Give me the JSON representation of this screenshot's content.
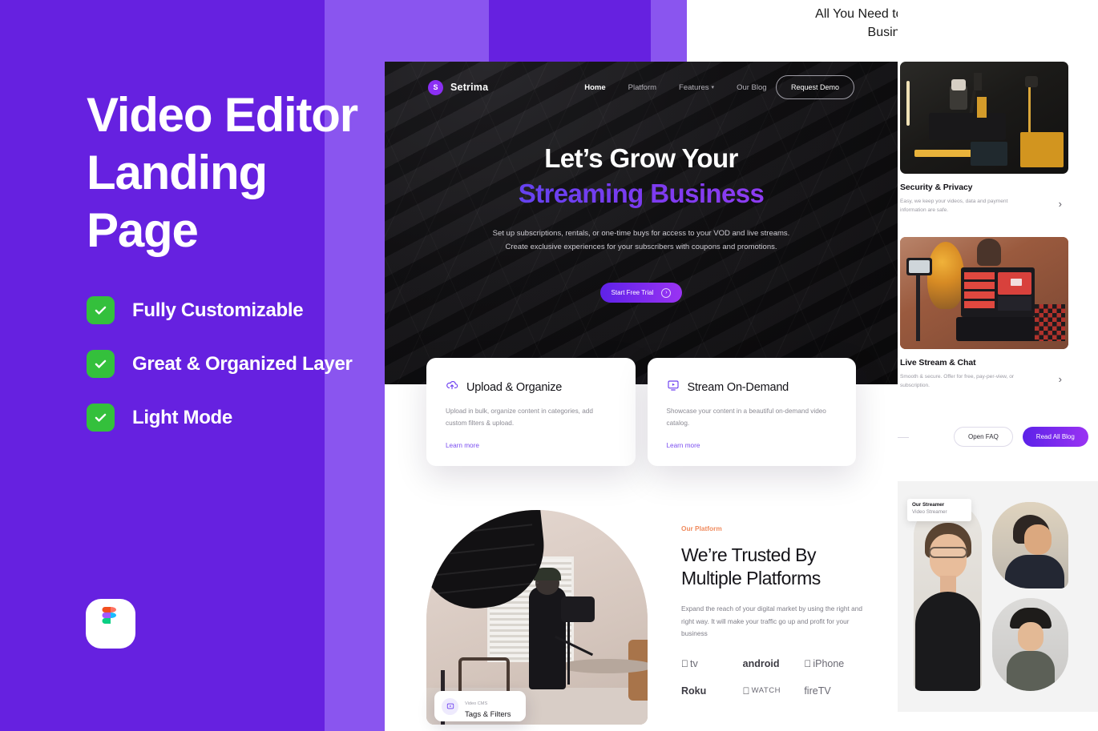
{
  "poster": {
    "title_line1": "Video Editor",
    "title_line2": "Landing Page",
    "features": [
      {
        "label": "Fully Customizable",
        "icon": "check-icon"
      },
      {
        "label": "Great & Organized Layer",
        "icon": "check-icon"
      },
      {
        "label": "Light Mode",
        "icon": "check-icon"
      }
    ],
    "badge_icon": "figma-logo-icon",
    "bg_colors": [
      "#6621e0",
      "#8a55ef"
    ],
    "check_color": "#34c03c"
  },
  "top_right_heading": "All You Need to Power Your Business",
  "mockup": {
    "nav": {
      "brand_initial": "S",
      "brand_name": "Setrima",
      "links": [
        {
          "label": "Home",
          "active": true
        },
        {
          "label": "Platform",
          "active": false
        },
        {
          "label": "Features",
          "active": false,
          "caret": "▾"
        },
        {
          "label": "Our Blog",
          "active": false
        }
      ],
      "cta": "Request Demo"
    },
    "hero": {
      "headline_line1": "Let’s Grow Your",
      "headline_line2": "Streaming Business",
      "sub_line1": "Set up subscriptions, rentals, or one-time buys for access to your VOD and live streams.",
      "sub_line2": "Create exclusive experiences for your subscribers with coupons and promotions.",
      "cta_label": "Start Free Trial",
      "cta_icon": "arrow-right-circle-icon",
      "gradient": [
        "#4d4bf0",
        "#a23df2"
      ]
    },
    "cards": [
      {
        "icon": "cloud-upload-icon",
        "title": "Upload & Organize",
        "text": "Upload in bulk, organize content in categories, add custom filters & upload.",
        "link": "Learn more"
      },
      {
        "icon": "video-play-icon",
        "title": "Stream On-Demand",
        "text": "Showcase your content in a beautiful on-demand video catalog.",
        "link": "Learn more"
      }
    ],
    "trusted": {
      "eyebrow": "Our Platform",
      "heading_line1": "We’re Trusted By",
      "heading_line2": "Multiple Platforms",
      "paragraph": "Expand the reach of your digital market by using the right and right way. It will make your traffic go up and profit for your business",
      "photo_chip": {
        "icon": "video-play-icon",
        "subtitle": "Video CMS",
        "title": "Tags & Filters"
      },
      "logos": [
        {
          "label": "tv",
          "apple": true,
          "bold": false
        },
        {
          "label": "android",
          "apple": false,
          "bold": true
        },
        {
          "label": "iPhone",
          "apple": true,
          "bold": false
        },
        {
          "label": "Roku",
          "apple": false,
          "bold": true
        },
        {
          "label": "WATCH",
          "apple": true,
          "bold": false
        },
        {
          "label": "fireTV",
          "apple": false,
          "bold": false
        }
      ]
    }
  },
  "sidebar": {
    "items": [
      {
        "image": "studio-camera-photo",
        "title": "Security & Privacy",
        "text": "Easy, we keep your videos, data and payment information are safe.",
        "chevron": "chevron-right-icon"
      },
      {
        "image": "live-stream-setup-photo",
        "title": "Live Stream & Chat",
        "text": "Smooth & secure. Offer for free, pay-per-view, or subscription.",
        "chevron": "chevron-right-icon"
      }
    ],
    "buttons": [
      {
        "label": "Open FAQ",
        "style": "ghost"
      },
      {
        "label": "Read All Blog",
        "style": "solid"
      }
    ],
    "avatars": {
      "main_chip": {
        "title": "Our Streamer",
        "subtitle": "Video Streamer"
      }
    }
  }
}
